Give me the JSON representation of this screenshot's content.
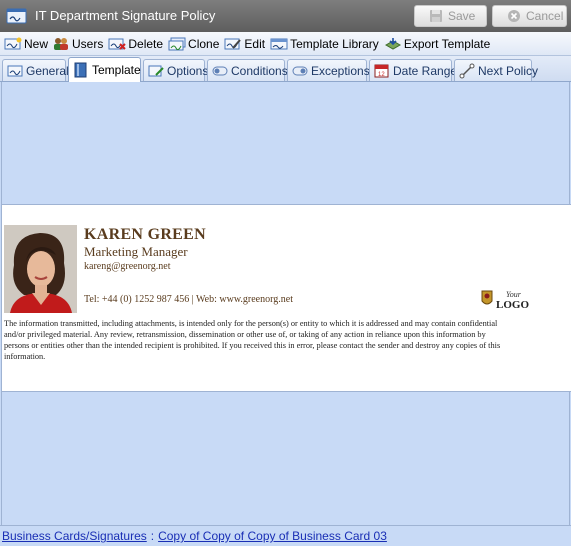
{
  "window": {
    "title": "IT Department Signature Policy",
    "save_label": "Save",
    "cancel_label": "Cancel"
  },
  "toolbar": {
    "new": "New",
    "users": "Users",
    "delete": "Delete",
    "clone": "Clone",
    "edit": "Edit",
    "template_library": "Template Library",
    "export_template": "Export Template"
  },
  "tabs": {
    "general": "General",
    "template": "Template",
    "options": "Options",
    "conditions": "Conditions",
    "exceptions": "Exceptions",
    "date_range": "Date Range",
    "next_policy": "Next Policy",
    "active": "Template"
  },
  "signature": {
    "name": "KAREN GREEN",
    "title": "Marketing Manager",
    "email": "kareng@greenorg.net",
    "contact": "Tel: +44 (0) 1252 987 456 | Web: www.greenorg.net",
    "logo_text": "Your LOGO",
    "disclaimer": "The information transmitted, including attachments, is intended only for the person(s) or entity to which it is addressed and may contain confidential and/or privileged material. Any review, retransmission, dissemination or other use of, or taking of any action in reliance upon this information by persons or entities other than the intended recipient is prohibited. If you received this in error, please contact the sender and destroy any copies of this information."
  },
  "breadcrumb": {
    "root": "Business Cards/Signatures",
    "separator": ":",
    "current": "Copy of Copy of Copy of Business Card 03"
  },
  "colors": {
    "accent": "#c8daf6",
    "signature_text": "#5a3c1e",
    "link": "#1a2fb5"
  }
}
